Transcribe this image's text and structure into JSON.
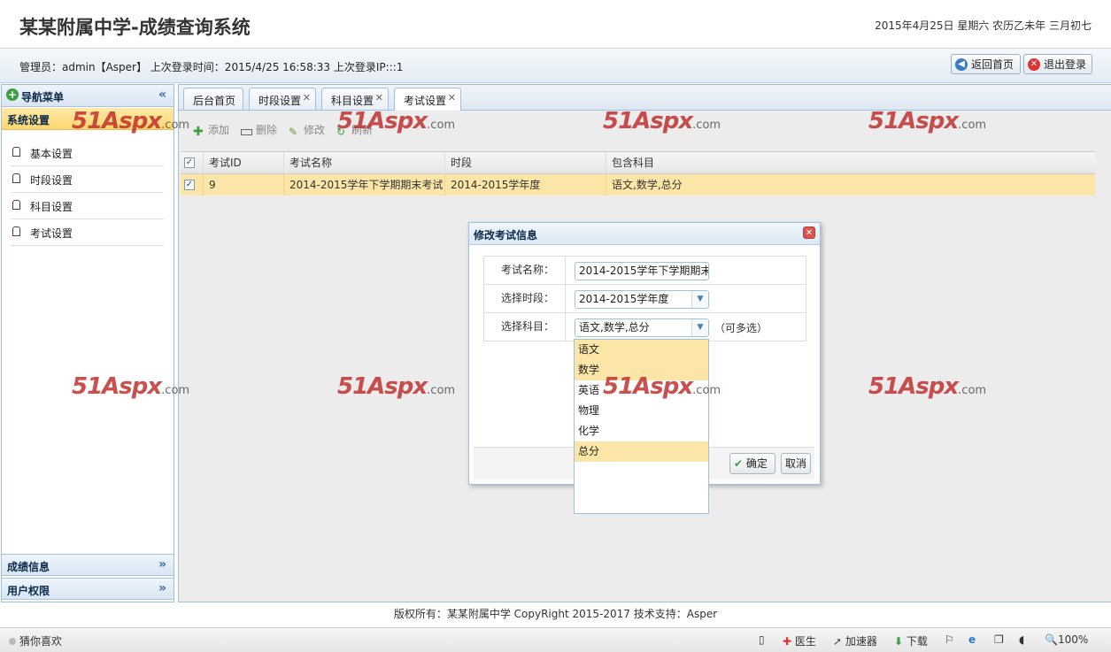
{
  "header": {
    "title": "某某附属中学-成绩查询系统",
    "date": "2015年4月25日 星期六 农历乙未年 三月初七"
  },
  "infobar": {
    "admin_text": "管理员：admin【Asper】 上次登录时间：2015/4/25 16:58:33 上次登录IP:::1",
    "home_button": "返回首页",
    "logout_button": "退出登录"
  },
  "nav": {
    "title": "导航菜单",
    "section": "系统设置",
    "items": [
      {
        "label": "基本设置"
      },
      {
        "label": "时段设置"
      },
      {
        "label": "科目设置"
      },
      {
        "label": "考试设置"
      }
    ],
    "bottom_sections": [
      "成绩信息",
      "用户权限"
    ]
  },
  "tabs": [
    {
      "label": "后台首页",
      "closable": false
    },
    {
      "label": "时段设置",
      "closable": true
    },
    {
      "label": "科目设置",
      "closable": true
    },
    {
      "label": "考试设置",
      "closable": true,
      "active": true
    }
  ],
  "toolbar": {
    "add": "添加",
    "delete": "删除",
    "edit": "修改",
    "refresh": "刷新"
  },
  "grid": {
    "columns": [
      "考试ID",
      "考试名称",
      "时段",
      "包含科目"
    ],
    "rows": [
      {
        "id": "9",
        "name": "2014-2015学年下学期期末考试",
        "period": "2014-2015学年度",
        "subjects": "语文,数学,总分",
        "checked": true
      }
    ]
  },
  "dialog": {
    "title": "修改考试信息",
    "fields": {
      "name_label": "考试名称：",
      "name_value": "2014-2015学年下学期期末",
      "period_label": "选择时段：",
      "period_value": "2014-2015学年度",
      "subject_label": "选择科目：",
      "subject_value": "语文,数学,总分",
      "subject_hint": "（可多选）"
    },
    "ok_button": "确定",
    "cancel_button": "取消"
  },
  "dropdown": {
    "options": [
      {
        "label": "语文",
        "selected": true
      },
      {
        "label": "数学",
        "selected": true
      },
      {
        "label": "英语",
        "selected": false
      },
      {
        "label": "物理",
        "selected": false
      },
      {
        "label": "化学",
        "selected": false
      },
      {
        "label": "总分",
        "selected": true
      }
    ]
  },
  "watermark": {
    "brand": "51Aspx",
    "suffix": ".com"
  },
  "footer": {
    "copyright": "版权所有：某某附属中学 CopyRight 2015-2017 技术支持：Asper"
  },
  "statusbar": {
    "guess": "猜你喜欢",
    "doctor": "医生",
    "accelerator": "加速器",
    "download": "下载",
    "zoom": "100%"
  },
  "colors": {
    "selected_row": "#fbe6a7",
    "accent_blue": "#9fbfdf",
    "close_red": "#d9534f"
  }
}
